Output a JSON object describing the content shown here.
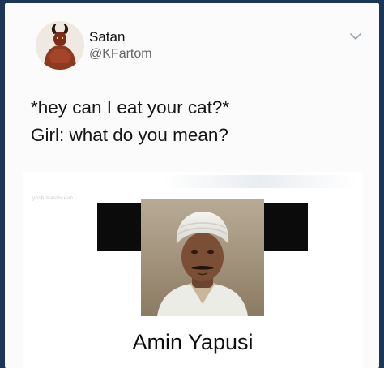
{
  "tweet": {
    "author_name": "Satan",
    "author_handle": "@KFartom",
    "text": "*hey can I eat your cat?*\nGirl: what do you mean?"
  },
  "icons": {
    "avatar": "devil-avatar",
    "menu": "chevron-down-icon"
  },
  "media": {
    "caption": "Amin Yapusi",
    "watermark": "yoshimastoceon"
  },
  "colors": {
    "page_background": "#1d3557",
    "card_background": "#fbfbfb",
    "handle_color": "#666666",
    "text_color": "#151515"
  }
}
